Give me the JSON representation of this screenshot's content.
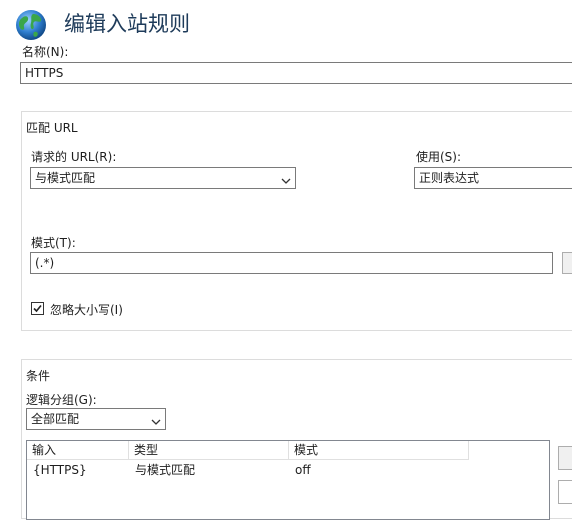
{
  "header": {
    "title": "编辑入站规则",
    "icon": "globe-icon"
  },
  "name_field": {
    "label": "名称(N):",
    "value": "HTTPS"
  },
  "match_url": {
    "legend": "匹配 URL",
    "requested_url_label": "请求的 URL(R):",
    "requested_url_value": "与模式匹配",
    "using_label": "使用(S):",
    "using_value": "正则表达式",
    "pattern_label": "模式(T):",
    "pattern_value": "(.*)",
    "ignore_case_label": "忽略大小写(I)",
    "ignore_case_checked": true
  },
  "conditions": {
    "legend": "条件",
    "logical_grouping_label": "逻辑分组(G):",
    "logical_grouping_value": "全部匹配",
    "table": {
      "columns": [
        "输入",
        "类型",
        "模式"
      ],
      "rows": [
        {
          "input": "{HTTPS}",
          "type": "与模式匹配",
          "pattern": "off"
        }
      ]
    }
  },
  "colors": {
    "title": "#1e3b5a",
    "border": "#7a7a7a",
    "group_border": "#dcdcdc"
  }
}
